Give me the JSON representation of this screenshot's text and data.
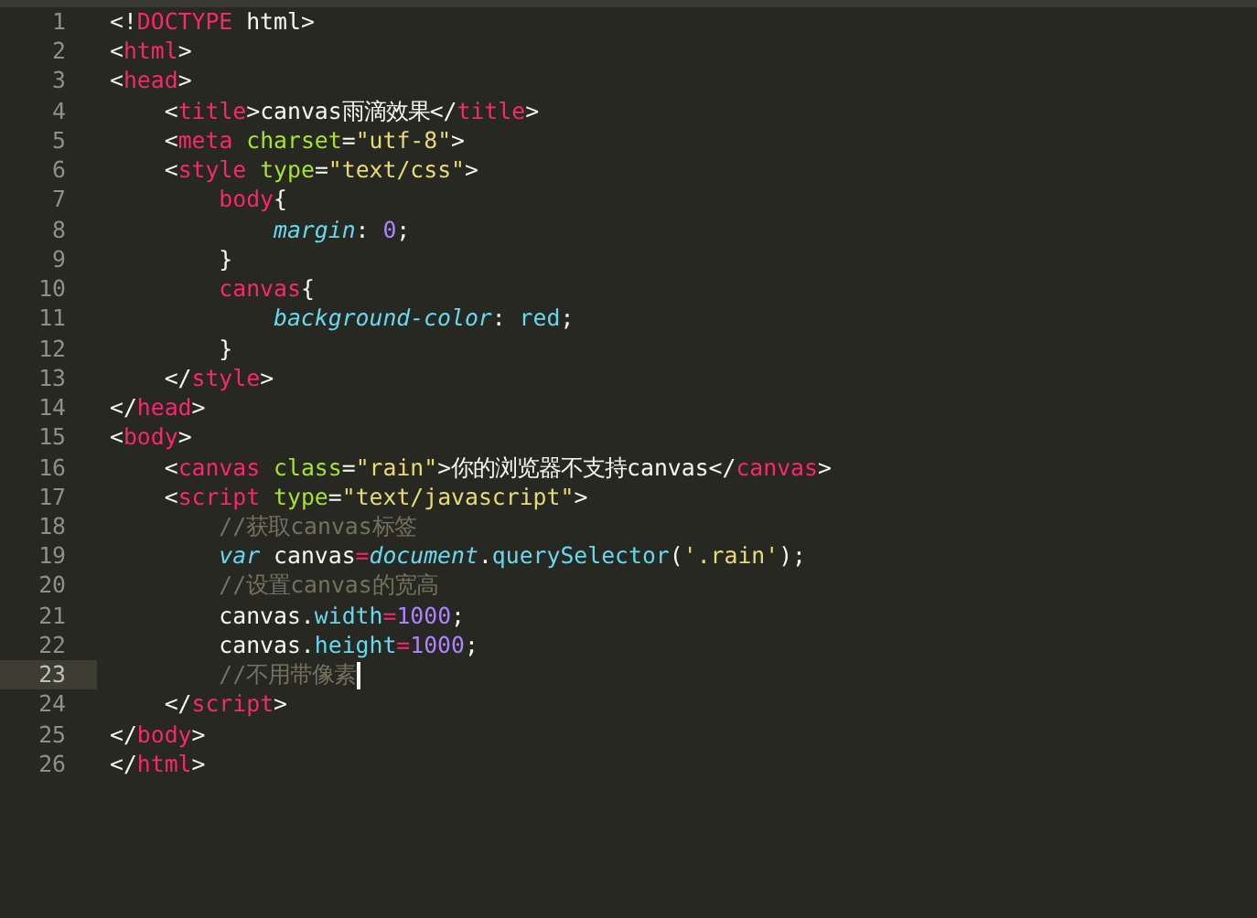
{
  "editor": {
    "lines": [
      {
        "number": "1",
        "current": false,
        "tokens": [
          {
            "kind": "plain",
            "text": "<!"
          },
          {
            "kind": "tag",
            "text": "DOCTYPE"
          },
          {
            "kind": "plain",
            "text": " html>"
          }
        ]
      },
      {
        "number": "2",
        "current": false,
        "tokens": [
          {
            "kind": "plain",
            "text": "<"
          },
          {
            "kind": "tag",
            "text": "html"
          },
          {
            "kind": "plain",
            "text": ">"
          }
        ]
      },
      {
        "number": "3",
        "current": false,
        "tokens": [
          {
            "kind": "plain",
            "text": "<"
          },
          {
            "kind": "tag",
            "text": "head"
          },
          {
            "kind": "plain",
            "text": ">"
          }
        ]
      },
      {
        "number": "4",
        "current": false,
        "tokens": [
          {
            "kind": "plain",
            "text": "    <"
          },
          {
            "kind": "tag",
            "text": "title"
          },
          {
            "kind": "plain",
            "text": ">canvas雨滴效果</"
          },
          {
            "kind": "tag",
            "text": "title"
          },
          {
            "kind": "plain",
            "text": ">"
          }
        ]
      },
      {
        "number": "5",
        "current": false,
        "tokens": [
          {
            "kind": "plain",
            "text": "    <"
          },
          {
            "kind": "tag",
            "text": "meta"
          },
          {
            "kind": "attr",
            "text": " charset"
          },
          {
            "kind": "plain",
            "text": "="
          },
          {
            "kind": "string",
            "text": "\"utf-8\""
          },
          {
            "kind": "plain",
            "text": ">"
          }
        ]
      },
      {
        "number": "6",
        "current": false,
        "tokens": [
          {
            "kind": "plain",
            "text": "    <"
          },
          {
            "kind": "tag",
            "text": "style"
          },
          {
            "kind": "attr",
            "text": " type"
          },
          {
            "kind": "plain",
            "text": "="
          },
          {
            "kind": "string",
            "text": "\"text/css\""
          },
          {
            "kind": "plain",
            "text": ">"
          }
        ]
      },
      {
        "number": "7",
        "current": false,
        "tokens": [
          {
            "kind": "tag",
            "text": "        body"
          },
          {
            "kind": "plain",
            "text": "{"
          }
        ]
      },
      {
        "number": "8",
        "current": false,
        "tokens": [
          {
            "kind": "prop",
            "text": "            margin"
          },
          {
            "kind": "plain",
            "text": ": "
          },
          {
            "kind": "number",
            "text": "0"
          },
          {
            "kind": "plain",
            "text": ";"
          }
        ]
      },
      {
        "number": "9",
        "current": false,
        "tokens": [
          {
            "kind": "plain",
            "text": "        }"
          }
        ]
      },
      {
        "number": "10",
        "current": false,
        "tokens": [
          {
            "kind": "tag",
            "text": "        canvas"
          },
          {
            "kind": "plain",
            "text": "{"
          }
        ]
      },
      {
        "number": "11",
        "current": false,
        "tokens": [
          {
            "kind": "prop",
            "text": "            background-color"
          },
          {
            "kind": "plain",
            "text": ": "
          },
          {
            "kind": "value",
            "text": "red"
          },
          {
            "kind": "plain",
            "text": ";"
          }
        ]
      },
      {
        "number": "12",
        "current": false,
        "tokens": [
          {
            "kind": "plain",
            "text": "        }"
          }
        ]
      },
      {
        "number": "13",
        "current": false,
        "tokens": [
          {
            "kind": "plain",
            "text": "    </"
          },
          {
            "kind": "tag",
            "text": "style"
          },
          {
            "kind": "plain",
            "text": ">"
          }
        ]
      },
      {
        "number": "14",
        "current": false,
        "tokens": [
          {
            "kind": "plain",
            "text": "</"
          },
          {
            "kind": "tag",
            "text": "head"
          },
          {
            "kind": "plain",
            "text": ">"
          }
        ]
      },
      {
        "number": "15",
        "current": false,
        "tokens": [
          {
            "kind": "plain",
            "text": "<"
          },
          {
            "kind": "tag",
            "text": "body"
          },
          {
            "kind": "plain",
            "text": ">"
          }
        ]
      },
      {
        "number": "16",
        "current": false,
        "tokens": [
          {
            "kind": "plain",
            "text": "    <"
          },
          {
            "kind": "tag",
            "text": "canvas"
          },
          {
            "kind": "attr",
            "text": " class"
          },
          {
            "kind": "plain",
            "text": "="
          },
          {
            "kind": "string",
            "text": "\"rain\""
          },
          {
            "kind": "plain",
            "text": ">你的浏览器不支持canvas</"
          },
          {
            "kind": "tag",
            "text": "canvas"
          },
          {
            "kind": "plain",
            "text": ">"
          }
        ]
      },
      {
        "number": "17",
        "current": false,
        "tokens": [
          {
            "kind": "plain",
            "text": "    <"
          },
          {
            "kind": "tag",
            "text": "script"
          },
          {
            "kind": "attr",
            "text": " type"
          },
          {
            "kind": "plain",
            "text": "="
          },
          {
            "kind": "string",
            "text": "\"text/javascript\""
          },
          {
            "kind": "plain",
            "text": ">"
          }
        ]
      },
      {
        "number": "18",
        "current": false,
        "tokens": [
          {
            "kind": "comment",
            "text": "        //获取canvas标签"
          }
        ]
      },
      {
        "number": "19",
        "current": false,
        "tokens": [
          {
            "kind": "keyword",
            "text": "        var"
          },
          {
            "kind": "plain",
            "text": " canvas"
          },
          {
            "kind": "operator",
            "text": "="
          },
          {
            "kind": "builtin",
            "text": "document"
          },
          {
            "kind": "plain",
            "text": "."
          },
          {
            "kind": "func",
            "text": "querySelector"
          },
          {
            "kind": "plain",
            "text": "("
          },
          {
            "kind": "string",
            "text": "'.rain'"
          },
          {
            "kind": "plain",
            "text": ");"
          }
        ]
      },
      {
        "number": "20",
        "current": false,
        "tokens": [
          {
            "kind": "comment",
            "text": "        //设置canvas的宽高"
          }
        ]
      },
      {
        "number": "21",
        "current": false,
        "tokens": [
          {
            "kind": "plain",
            "text": "        canvas."
          },
          {
            "kind": "func",
            "text": "width"
          },
          {
            "kind": "operator",
            "text": "="
          },
          {
            "kind": "number",
            "text": "1000"
          },
          {
            "kind": "plain",
            "text": ";"
          }
        ]
      },
      {
        "number": "22",
        "current": false,
        "tokens": [
          {
            "kind": "plain",
            "text": "        canvas."
          },
          {
            "kind": "func",
            "text": "height"
          },
          {
            "kind": "operator",
            "text": "="
          },
          {
            "kind": "number",
            "text": "1000"
          },
          {
            "kind": "plain",
            "text": ";"
          }
        ]
      },
      {
        "number": "23",
        "current": true,
        "tokens": [
          {
            "kind": "comment",
            "text": "        //不用带像素"
          }
        ]
      },
      {
        "number": "24",
        "current": false,
        "tokens": [
          {
            "kind": "plain",
            "text": "    </"
          },
          {
            "kind": "tag",
            "text": "script"
          },
          {
            "kind": "plain",
            "text": ">"
          }
        ]
      },
      {
        "number": "25",
        "current": false,
        "tokens": [
          {
            "kind": "plain",
            "text": "</"
          },
          {
            "kind": "tag",
            "text": "body"
          },
          {
            "kind": "plain",
            "text": ">"
          }
        ]
      },
      {
        "number": "26",
        "current": false,
        "tokens": [
          {
            "kind": "plain",
            "text": "</"
          },
          {
            "kind": "tag",
            "text": "html"
          },
          {
            "kind": "plain",
            "text": ">"
          }
        ]
      }
    ]
  }
}
